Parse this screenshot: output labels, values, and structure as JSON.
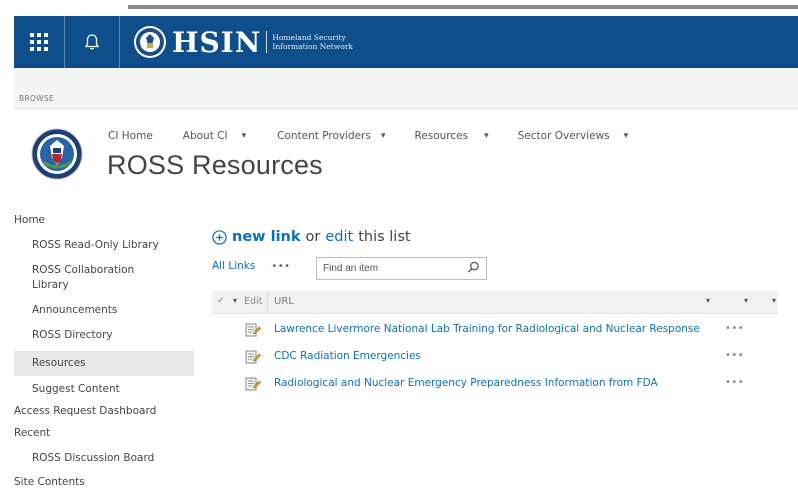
{
  "suitebar": {
    "brand": "HSIN",
    "brand_sub_line1": "Homeland Security",
    "brand_sub_line2": "Information Network",
    "bg_color": "#0e4f8b"
  },
  "ribbon": {
    "browse_label": "BROWSE"
  },
  "topnav": {
    "items": [
      {
        "label": "CI Home",
        "has_caret": false
      },
      {
        "label": "About CI",
        "has_caret": true
      },
      {
        "label": "Content Providers",
        "has_caret": true
      },
      {
        "label": "Resources",
        "has_caret": true
      },
      {
        "label": "Sector Overviews",
        "has_caret": true
      }
    ],
    "caret_glyph": "▾"
  },
  "site": {
    "title": "ROSS Resources"
  },
  "quicklaunch": {
    "home": "Home",
    "read_only_library": "ROSS Read-Only Library",
    "collaboration_library": "ROSS Collaboration Library",
    "announcements": "Announcements",
    "directory": "ROSS Directory",
    "resources": "Resources",
    "suggest_content": "Suggest Content",
    "access_request_dashboard": "Access Request Dashboard",
    "recent": "Recent",
    "discussion_board": "ROSS Discussion Board",
    "site_contents": "Site Contents"
  },
  "actions": {
    "new_link": "new link",
    "or": "or",
    "edit": "edit",
    "this_list": "this list"
  },
  "view": {
    "name": "All Links",
    "more": "•••",
    "search_placeholder": "Find an item"
  },
  "list": {
    "header_edit": "Edit",
    "header_url": "URL",
    "header_check": "✓",
    "header_caret": "▾",
    "row_menu": "•••",
    "items": [
      {
        "title": "Lawrence Livermore National Lab Training for Radiological and Nuclear Response"
      },
      {
        "title": "CDC Radiation Emergencies"
      },
      {
        "title": "Radiological and Nuclear Emergency Preparedness Information from FDA"
      }
    ]
  },
  "colors": {
    "link": "#0e6fb4",
    "selected_nav_bg": "#e8e8e8"
  }
}
